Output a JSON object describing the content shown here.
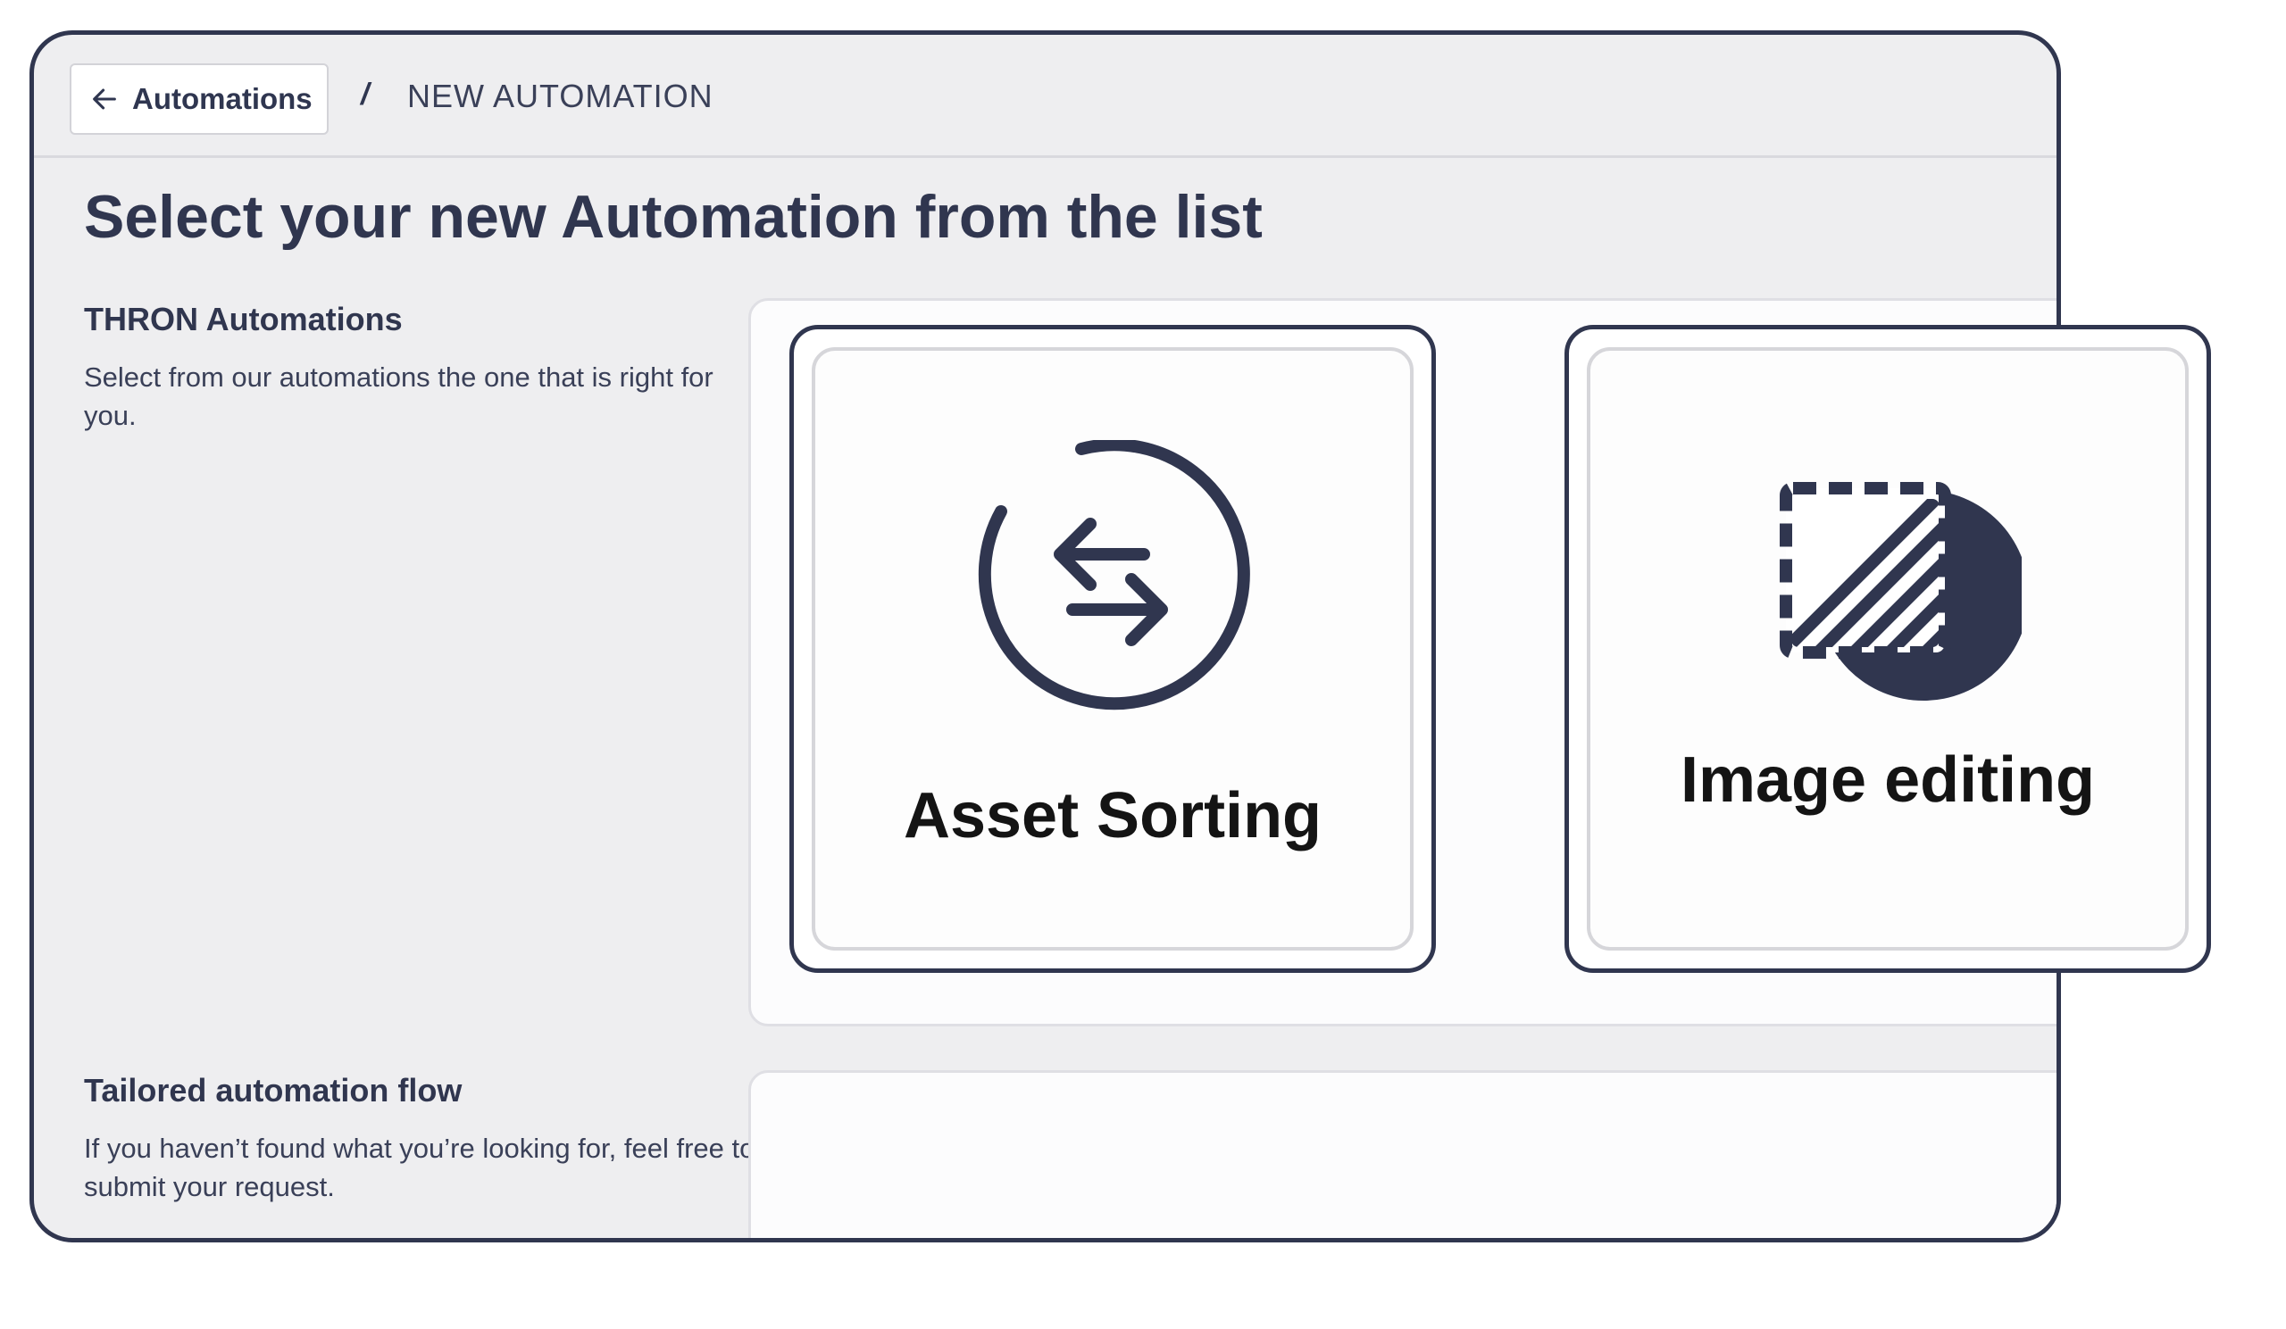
{
  "topbar": {
    "back_label": "Automations",
    "separator": "/",
    "current": "NEW AUTOMATION"
  },
  "page_title": "Select your new Automation from the list",
  "thron_section": {
    "title": "THRON Automations",
    "description": "Select from our automations the one that is right for you."
  },
  "tailored_section": {
    "title": "Tailored automation flow",
    "description": "If you haven’t found what you’re looking for, feel free to submit your request."
  },
  "cards": [
    {
      "label": "Asset Sorting",
      "icon": "swap-arrows-icon"
    },
    {
      "label": "Image editing",
      "icon": "image-crop-icon"
    }
  ],
  "colors": {
    "frame": "#30364f",
    "background": "#eeeef0",
    "card": "#ffffff"
  }
}
